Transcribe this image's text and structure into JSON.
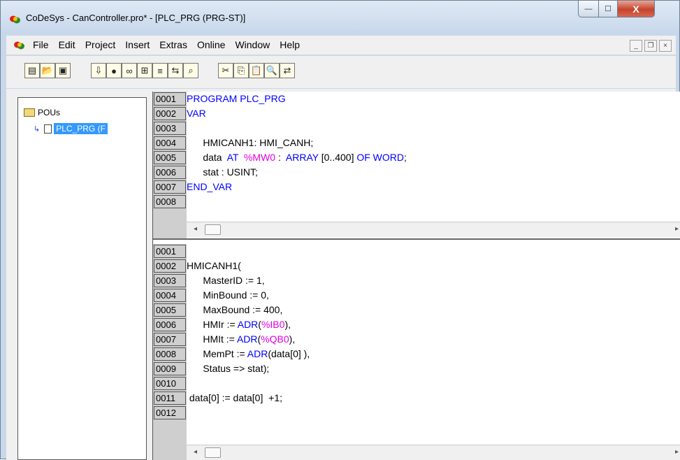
{
  "window": {
    "title": "CoDeSys - CanController.pro* - [PLC_PRG (PRG-ST)]",
    "min_glyph": "—",
    "max_glyph": "☐",
    "close_glyph": "X"
  },
  "menu": {
    "items": [
      "File",
      "Edit",
      "Project",
      "Insert",
      "Extras",
      "Online",
      "Window",
      "Help"
    ],
    "mdi": {
      "min": "_",
      "restore": "❐",
      "close": "×"
    }
  },
  "toolbar": {
    "icons": [
      {
        "name": "new-icon",
        "glyph": "▤"
      },
      {
        "name": "open-icon",
        "glyph": "📂"
      },
      {
        "name": "save-icon",
        "glyph": "▣"
      },
      {
        "name": "login-icon",
        "glyph": "⇩"
      },
      {
        "name": "stop-icon",
        "glyph": "●"
      },
      {
        "name": "run-icon",
        "glyph": "∞"
      },
      {
        "name": "step-icon",
        "glyph": "⊞"
      },
      {
        "name": "breakpoint-icon",
        "glyph": "≡"
      },
      {
        "name": "watch-icon",
        "glyph": "⇆"
      },
      {
        "name": "find-icon",
        "glyph": "⌕"
      },
      {
        "name": "cut-icon",
        "glyph": "✂"
      },
      {
        "name": "copy-icon",
        "glyph": "⎘"
      },
      {
        "name": "paste-icon",
        "glyph": "📋"
      },
      {
        "name": "search-icon",
        "glyph": "🔍"
      },
      {
        "name": "replace-icon",
        "glyph": "⇄"
      }
    ]
  },
  "tree": {
    "root_label": "POUs",
    "child_label": "PLC_PRG (F"
  },
  "declaration": {
    "lines": [
      {
        "no": "0001",
        "parts": [
          {
            "t": "PROGRAM PLC_PRG",
            "c": "kw"
          }
        ]
      },
      {
        "no": "0002",
        "parts": [
          {
            "t": "VAR",
            "c": "kw"
          }
        ]
      },
      {
        "no": "0003",
        "parts": []
      },
      {
        "no": "0004",
        "parts": [
          {
            "t": "      HMICANH1: HMI_CANH;",
            "c": ""
          }
        ]
      },
      {
        "no": "0005",
        "parts": [
          {
            "t": "      data  ",
            "c": ""
          },
          {
            "t": "AT",
            "c": "kw"
          },
          {
            "t": "  ",
            "c": ""
          },
          {
            "t": "%MW0",
            "c": "pc"
          },
          {
            "t": " :  ",
            "c": ""
          },
          {
            "t": "ARRAY",
            "c": "kw"
          },
          {
            "t": " [0..400] ",
            "c": ""
          },
          {
            "t": "OF WORD",
            "c": "kw"
          },
          {
            "t": ";",
            "c": ""
          }
        ]
      },
      {
        "no": "0006",
        "parts": [
          {
            "t": "      stat : USINT;",
            "c": ""
          }
        ]
      },
      {
        "no": "0007",
        "parts": [
          {
            "t": "END_VAR",
            "c": "kw"
          }
        ]
      },
      {
        "no": "0008",
        "parts": []
      }
    ]
  },
  "implementation": {
    "lines": [
      {
        "no": "0001",
        "parts": []
      },
      {
        "no": "0002",
        "parts": [
          {
            "t": "HMICANH1(",
            "c": ""
          }
        ]
      },
      {
        "no": "0003",
        "parts": [
          {
            "t": "      MasterID := 1,",
            "c": ""
          }
        ]
      },
      {
        "no": "0004",
        "parts": [
          {
            "t": "      MinBound := 0,",
            "c": ""
          }
        ]
      },
      {
        "no": "0005",
        "parts": [
          {
            "t": "      MaxBound := 400,",
            "c": ""
          }
        ]
      },
      {
        "no": "0006",
        "parts": [
          {
            "t": "      HMIr := ",
            "c": ""
          },
          {
            "t": "ADR",
            "c": "kw"
          },
          {
            "t": "(",
            "c": ""
          },
          {
            "t": "%IB0",
            "c": "pc"
          },
          {
            "t": "),",
            "c": ""
          }
        ]
      },
      {
        "no": "0007",
        "parts": [
          {
            "t": "      HMIt := ",
            "c": ""
          },
          {
            "t": "ADR",
            "c": "kw"
          },
          {
            "t": "(",
            "c": ""
          },
          {
            "t": "%QB0",
            "c": "pc"
          },
          {
            "t": "),",
            "c": ""
          }
        ]
      },
      {
        "no": "0008",
        "parts": [
          {
            "t": "      MemPt := ",
            "c": ""
          },
          {
            "t": "ADR",
            "c": "kw"
          },
          {
            "t": "(data[0] ),",
            "c": ""
          }
        ]
      },
      {
        "no": "0009",
        "parts": [
          {
            "t": "      Status => stat);",
            "c": ""
          }
        ]
      },
      {
        "no": "0010",
        "parts": []
      },
      {
        "no": "0011",
        "parts": [
          {
            "t": " data[0] := data[0]  +1;",
            "c": ""
          }
        ]
      },
      {
        "no": "0012",
        "parts": []
      }
    ]
  },
  "scrollbar": {
    "left_arrow": "◂",
    "right_arrow": "▸"
  },
  "colors": {
    "keyword": "#0000ff",
    "address": "#e000e0",
    "selection": "#3399ff"
  }
}
